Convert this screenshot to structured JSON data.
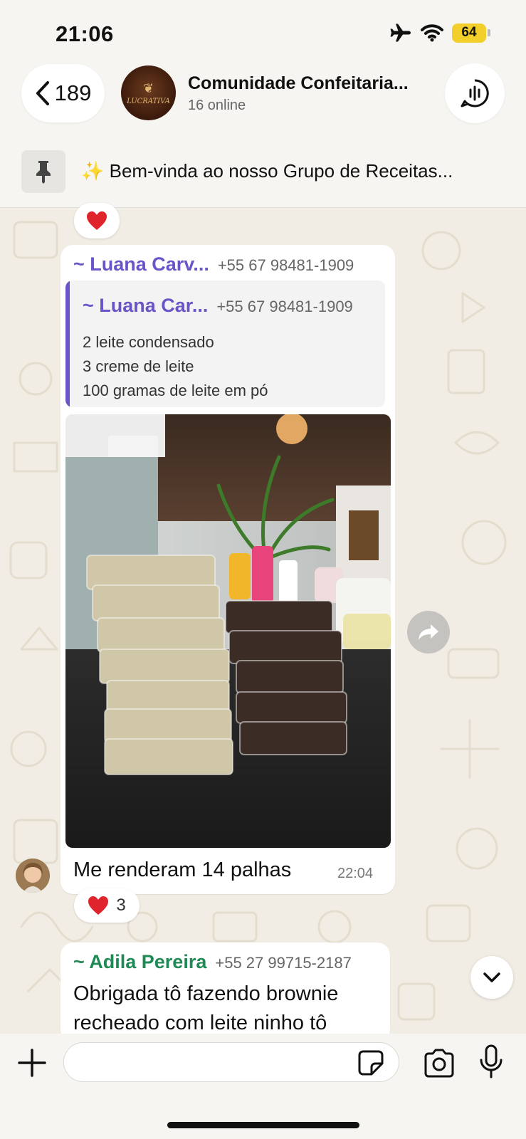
{
  "status_bar": {
    "time": "21:06",
    "battery": "64"
  },
  "header": {
    "back_count": "189",
    "group_name": "Comunidade Confeitaria...",
    "group_status": "16 online",
    "avatar_label": "LUCRATIVA"
  },
  "pinned": {
    "text": "✨ Bem-vinda ao nosso Grupo de Receitas..."
  },
  "messages": [
    {
      "sender": "~ Luana Carv...",
      "phone": "+55 67 98481-1909",
      "sender_color": "#6a54c8",
      "quote": {
        "sender": "~ Luana Car...",
        "phone": "+55 67 98481-1909",
        "lines": [
          "2 leite condensado",
          "3 creme de leite",
          "100 gramas de leite em pó"
        ]
      },
      "text": "Me renderam 14 palhas",
      "time": "22:04",
      "reaction_count": "3"
    },
    {
      "sender": "~ Adila Pereira",
      "phone": "+55 27 99715-2187",
      "sender_color": "#1f8a55",
      "text_lines": [
        "Obrigada tô fazendo brownie",
        "recheado com leite ninho tô"
      ]
    }
  ],
  "composer": {
    "placeholder": ""
  },
  "icons": {
    "back": "chevron-left-icon",
    "call": "group-call-icon",
    "pin": "pin-icon",
    "reaction": "heart-icon",
    "forward": "forward-icon",
    "scroll": "chevron-down-icon",
    "plus": "plus-icon",
    "sticker": "sticker-icon",
    "camera": "camera-icon",
    "mic": "microphone-icon"
  }
}
